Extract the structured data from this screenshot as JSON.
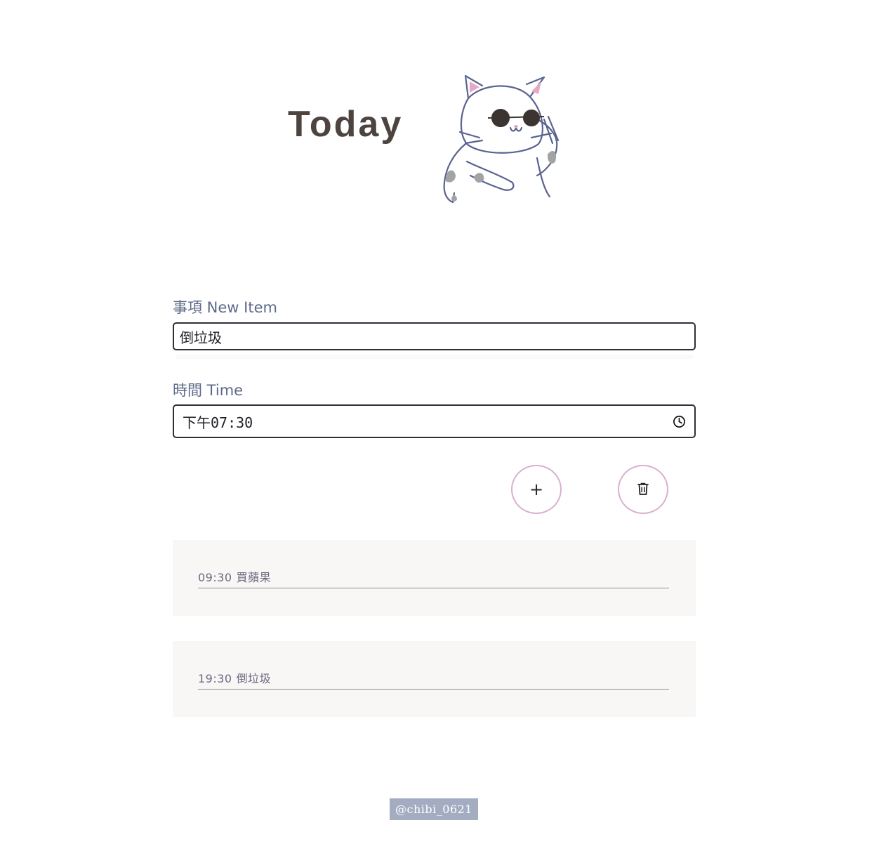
{
  "header": {
    "title": "Today",
    "illustration": "cat-with-sunglasses"
  },
  "form": {
    "item_label": "事項 New Item",
    "item_value": "倒垃圾",
    "time_label": "時間 Time",
    "time_value": "下午07:30",
    "time_icon": "clock-icon"
  },
  "actions": {
    "add_label": "+",
    "add_icon": "plus-icon",
    "delete_icon": "trash-icon"
  },
  "todos": [
    {
      "time": "09:30",
      "text": "買蘋果"
    },
    {
      "time": "19:30",
      "text": "倒垃圾"
    }
  ],
  "watermark": "@chibi_0621",
  "colors": {
    "title": "#4d4440",
    "label": "#5c6a88",
    "button_border": "#d9b0cf",
    "card_bg": "#f8f7f5",
    "watermark_bg": "#a4acc2"
  }
}
